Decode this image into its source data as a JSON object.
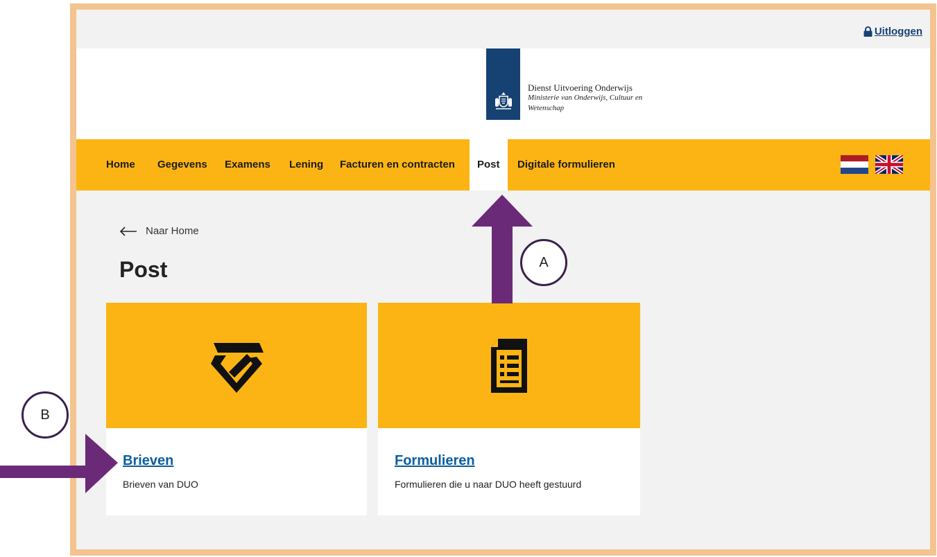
{
  "colors": {
    "frame_border": "#f3c48f",
    "nav_bg": "#fbb413",
    "brand_blue": "#154273",
    "link_blue": "#0b5ea0",
    "annotation_purple": "#6b2a78"
  },
  "topbar": {
    "logout_label": "Uitloggen",
    "logout_icon": "lock-icon"
  },
  "logo": {
    "line1": "Dienst Uitvoering Onderwijs",
    "line2": "Ministerie van Onderwijs, Cultuur en",
    "line3": "Wetenschap",
    "emblem": "royal-coat-of-arms-icon"
  },
  "nav": {
    "items": [
      {
        "label": "Home"
      },
      {
        "label": "Gegevens"
      },
      {
        "label": "Examens"
      },
      {
        "label": "Lening"
      },
      {
        "label": "Facturen en contracten"
      },
      {
        "label": "Post"
      },
      {
        "label": "Digitale formulieren"
      }
    ],
    "active": "Post",
    "languages": [
      "nl-flag-icon",
      "uk-flag-icon"
    ]
  },
  "main": {
    "back_label": "Naar Home",
    "back_icon": "arrow-left-icon",
    "title": "Post",
    "cards": [
      {
        "title": "Brieven",
        "description": "Brieven van DUO",
        "icon": "letter-icon"
      },
      {
        "title": "Formulieren",
        "description": "Formulieren die u naar DUO heeft gestuurd",
        "icon": "form-document-icon"
      }
    ]
  },
  "annotations": {
    "a_label": "A",
    "b_label": "B"
  }
}
